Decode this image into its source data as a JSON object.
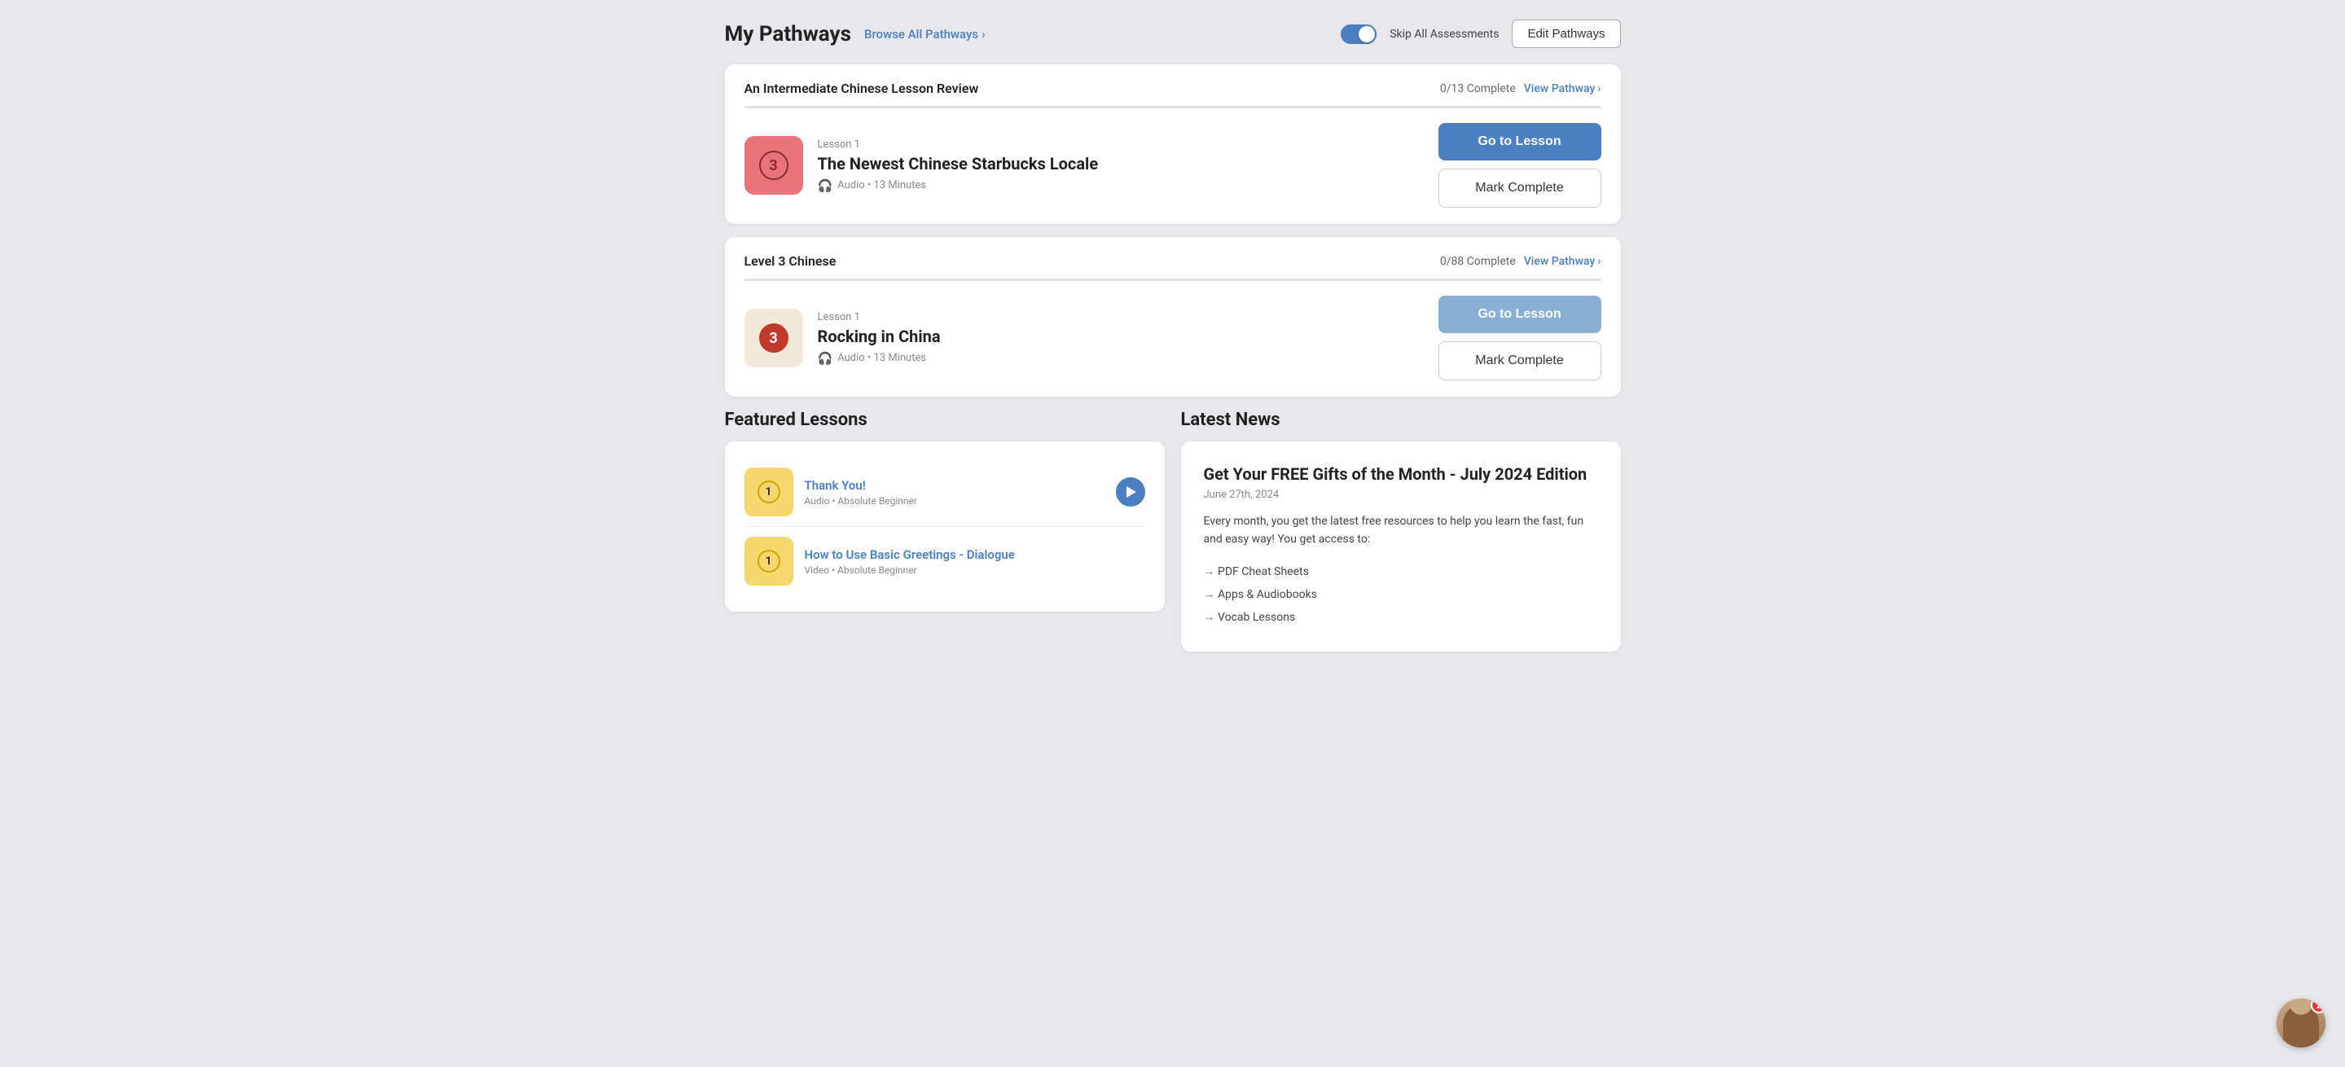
{
  "page": {
    "title": "My Pathways",
    "browse_link": "Browse All Pathways",
    "skip_label": "Skip All Assessments",
    "edit_btn": "Edit Pathways"
  },
  "pathways": [
    {
      "id": "intermediate-chinese",
      "name": "An Intermediate Chinese Lesson Review",
      "progress_text": "0/13 Complete",
      "view_link": "View Pathway",
      "progress_pct": 0,
      "lesson": {
        "label": "Lesson 1",
        "title": "The Newest Chinese Starbucks Locale",
        "type": "Audio",
        "duration": "13 Minutes",
        "thumb_num": "3",
        "thumb_style": "pink"
      },
      "go_btn": "Go to Lesson",
      "mark_btn": "Mark Complete"
    },
    {
      "id": "level3-chinese",
      "name": "Level 3 Chinese",
      "progress_text": "0/88 Complete",
      "view_link": "View Pathway",
      "progress_pct": 0,
      "lesson": {
        "label": "Lesson 1",
        "title": "Rocking in China",
        "type": "Audio",
        "duration": "13 Minutes",
        "thumb_num": "3",
        "thumb_style": "beige"
      },
      "go_btn": "Go to Lesson",
      "mark_btn": "Mark Complete"
    }
  ],
  "featured": {
    "title": "Featured Lessons",
    "lessons": [
      {
        "num": "1",
        "title": "Thank You!",
        "sub": "Audio • Absolute Beginner",
        "has_play": true
      },
      {
        "num": "1",
        "title": "How to Use Basic Greetings - Dialogue",
        "sub": "Video • Absolute Beginner",
        "has_play": false
      }
    ]
  },
  "news": {
    "title": "Latest News",
    "article": {
      "title": "Get Your FREE Gifts of the Month - July 2024 Edition",
      "date": "June 27th, 2024",
      "body": "Every month, you get the latest free resources to help you learn the fast, fun and easy way! You get access to:",
      "list": [
        "PDF Cheat Sheets",
        "Apps & Audiobooks",
        "Vocab Lessons"
      ]
    }
  },
  "chat": {
    "badge": "2"
  }
}
